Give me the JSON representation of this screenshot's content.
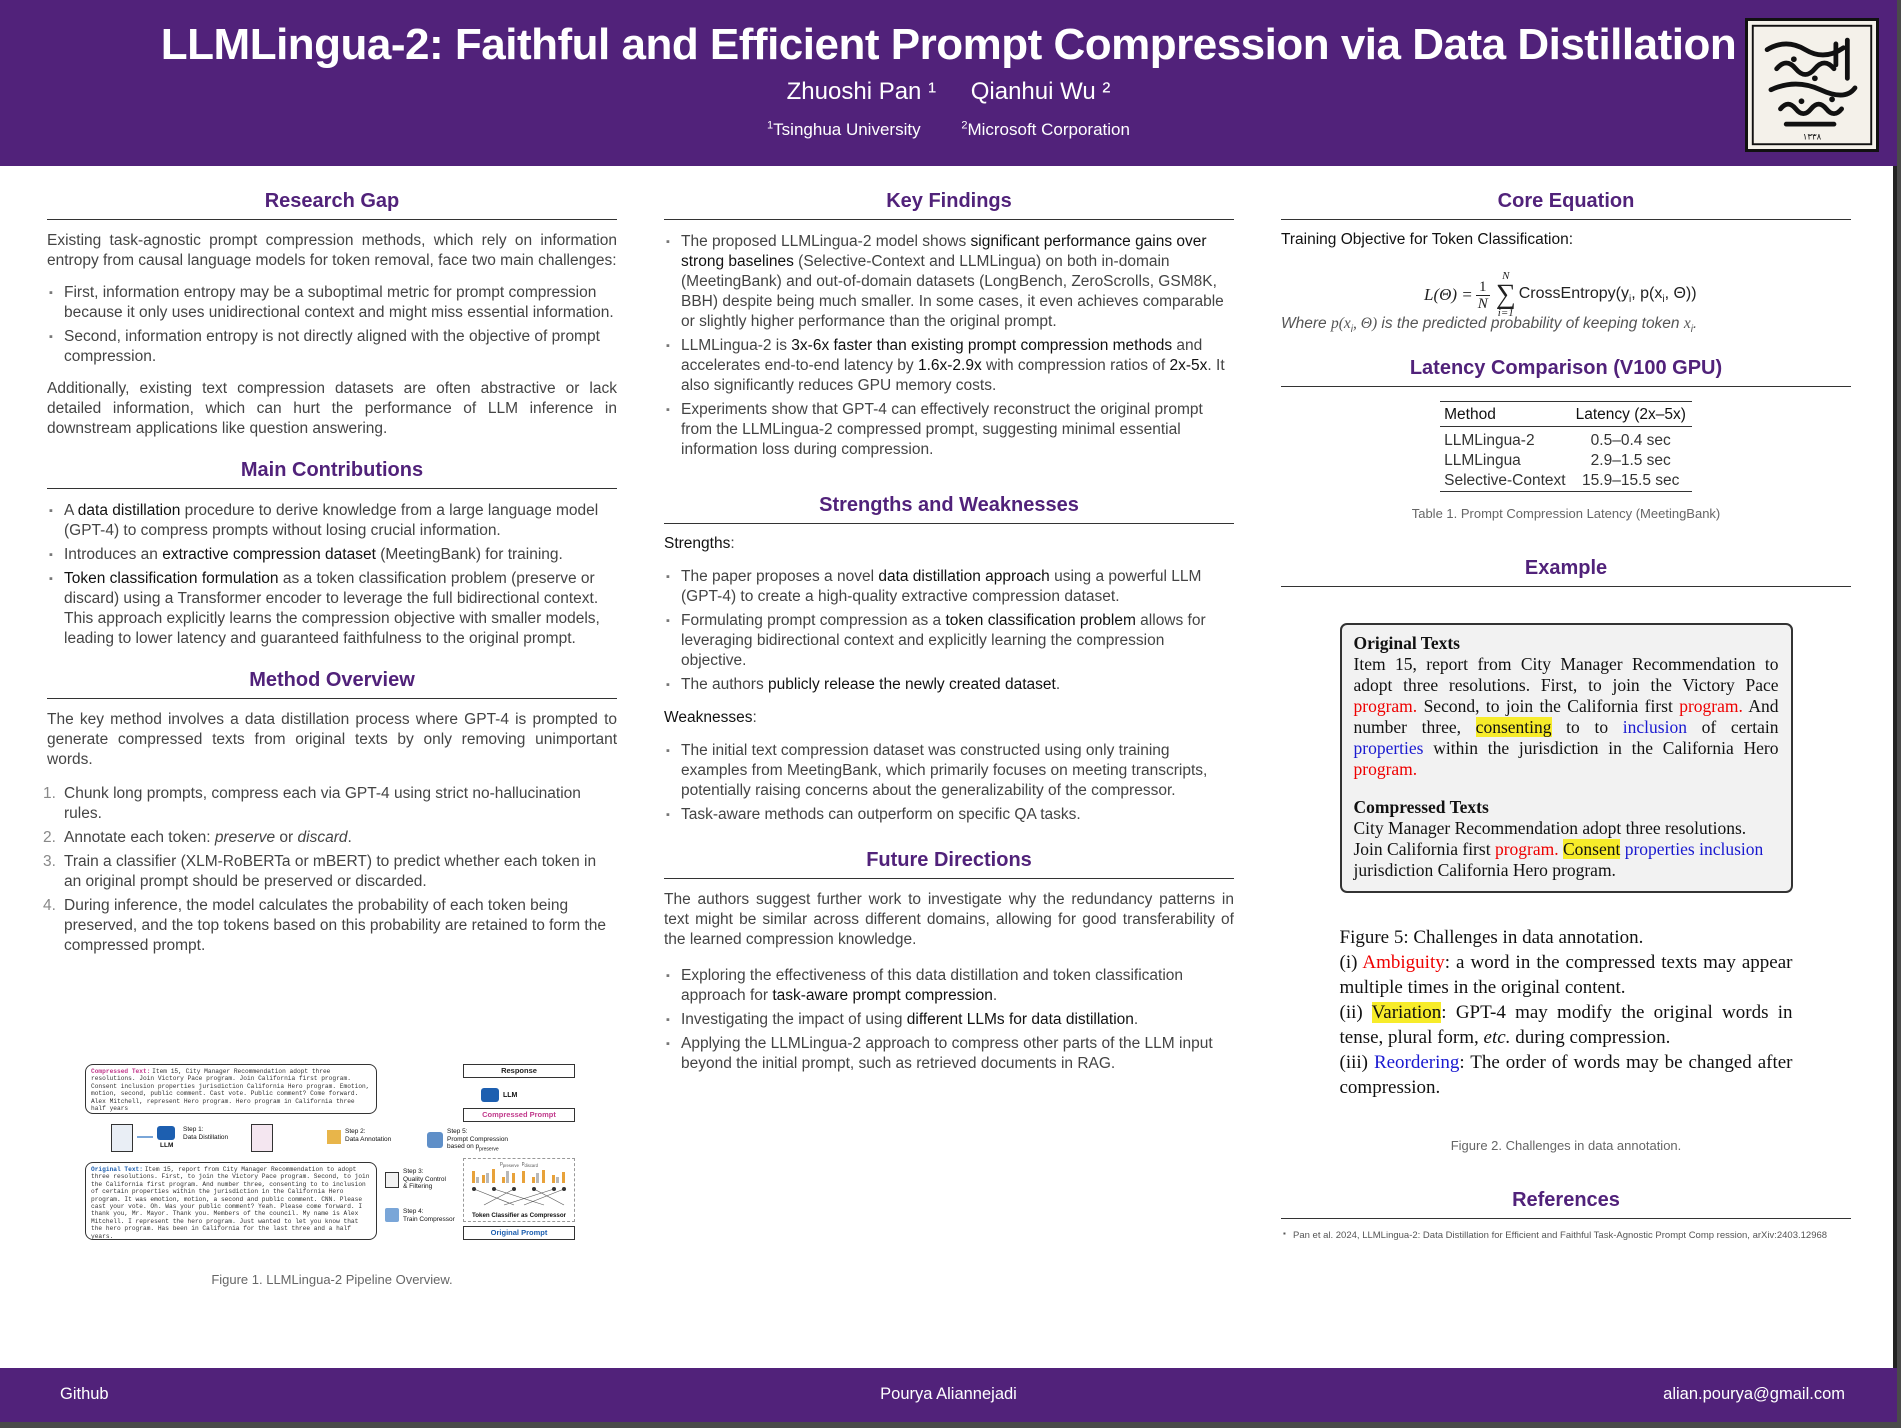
{
  "header": {
    "title": "LLMLingua-2: Faithful and Efficient Prompt Compression via Data Distillation",
    "authors": [
      "Zhuoshi Pan ¹",
      "Qianhui Wu ²"
    ],
    "affiliations": [
      {
        "sup": "1",
        "name": "Tsinghua University"
      },
      {
        "sup": "2",
        "name": "Microsoft Corporation"
      }
    ]
  },
  "research_gap": {
    "heading": "Research Gap",
    "intro": "Existing task-agnostic prompt compression methods, which rely on information entropy from causal language models for token removal, face two main challenges:",
    "bullets": [
      "First, information entropy may be a suboptimal metric for prompt compression because it only uses unidirectional context and might miss essential information.",
      "Second, information entropy is not directly aligned with the objective of prompt compression."
    ],
    "outro": "Additionally, existing text compression datasets are often abstractive or lack detailed information, which can hurt the performance of LLM inference in downstream applications like question answering."
  },
  "contributions": {
    "heading": "Main Contributions",
    "b1_pre": "A ",
    "b1_key": "data distillation",
    "b1_post": " procedure to derive knowledge from a large language model (GPT-4) to compress prompts without losing crucial information.",
    "b2_pre": "Introduces an ",
    "b2_key": "extractive compression dataset",
    "b2_post": " (MeetingBank) for training.",
    "b3_key": "Token classification formulation",
    "b3_post": " as a token classification problem (preserve or discard) using a Transformer encoder to leverage the full bidirectional context. This approach explicitly learns the compression objective with smaller models, leading to lower latency and guaranteed faithfulness to the original prompt."
  },
  "method": {
    "heading": "Method Overview",
    "intro": "The key method involves a data distillation process where GPT-4 is prompted to generate compressed texts from original texts by only removing unimportant words.",
    "steps": [
      {
        "n": "1.",
        "text": "Chunk long prompts, compress each via GPT-4 using strict no-hallucination rules."
      },
      {
        "n": "2.",
        "pre": "Annotate each token: ",
        "i1": "preserve",
        "mid": " or ",
        "i2": "discard",
        "post": "."
      },
      {
        "n": "3.",
        "text": "Train a classifier (XLM-RoBERTa or mBERT) to predict whether each token in an original prompt should be preserved or discarded."
      },
      {
        "n": "4.",
        "text": "During inference, the model calculates the probability of each token being preserved, and the top tokens based on this probability are retained to form the compressed prompt."
      }
    ],
    "figure_caption": "Figure 1. LLMLingua-2 Pipeline Overview.",
    "figure": {
      "compressed_label": "Compressed Text:",
      "compressed_body": "Item 15, City Manager Recommendation adopt three resolutions. Join Victory Pace program. Join California first program. Consent inclusion properties jurisdiction California Hero program. Emotion, motion, second, public comment. Cast vote. Public comment? Come forward. Alex Mitchell, represent Hero program. Hero program in California three half years",
      "original_label": "Original Text:",
      "original_body": "Item 15, report from City Manager Recommendation to adopt three resolutions. First, to join the Victory Pace program. Second, to join the California first program. And number three, consenting to to inclusion of certain properties within the jurisdiction in the California Hero program. It was emotion, motion, a second and public comment. CNN. Please cast your vote. Oh. Was your public comment? Yeah. Please come forward. I thank you, Mr. Mayor. Thank you. Members of the council. My name is Alex Mitchell. I represent the hero program. Just wanted to let you know that the hero program. Has been in California for the last three and a half years.",
      "step1": "Step 1:",
      "step1b": "Data Distillation",
      "step2": "Step 2:",
      "step2b": "Data Annotation",
      "step3": "Step 3:",
      "step3b": "Quality Control",
      "step3c": "& Filtering",
      "step4": "Step 4:",
      "step4b": "Train Compressor",
      "step5": "Step 5:",
      "step5b": "Prompt Compression",
      "step5c": "based on p",
      "step5d": "preserve",
      "llm": "LLM",
      "response": "Response",
      "compressed_prompt": "Compressed Prompt",
      "original_prompt": "Original Prompt",
      "classifier": "Token Classifier as Compressor",
      "legend1": "p",
      "legend1s": "preserve",
      "legend2": "p",
      "legend2s": "discard"
    }
  },
  "key_findings": {
    "heading": "Key Findings",
    "f1_pre": "The proposed LLMLingua-2 model shows ",
    "f1_key": "significant performance gains over strong baselines",
    "f1_post": " (Selective-Context and LLMLingua) on both in-domain (MeetingBank) and out-of-domain datasets (LongBench, ZeroScrolls, GSM8K, BBH) despite being much smaller. In some cases, it even achieves comparable or slightly higher performance than the original prompt.",
    "f2_pre": "LLMLingua-2 is ",
    "f2_key": "3x-6x faster than existing prompt compression methods",
    "f2_mid": " and accelerates end-to-end latency by ",
    "f2_key2": "1.6x-2.9x",
    "f2_mid2": " with compression ratios of ",
    "f2_key3": "2x-5x",
    "f2_post": ". It also significantly reduces GPU memory costs.",
    "f3": "Experiments show that GPT-4 can effectively reconstruct the original prompt from the LLMLingua-2 compressed prompt, suggesting minimal essential information loss during compression."
  },
  "strengths": {
    "heading": "Strengths and Weaknesses",
    "strengths_label": "Strengths",
    "s1_pre": "The paper proposes a novel ",
    "s1_key": "data distillation approach",
    "s1_post": " using a powerful LLM (GPT-4) to create a high-quality extractive compression dataset.",
    "s2_pre": "Formulating prompt compression as a ",
    "s2_key": "token classification problem",
    "s2_post": " allows for leveraging bidirectional context and explicitly learning the compression objective.",
    "s3_pre": "The authors ",
    "s3_key": "publicly release the newly created dataset",
    "s3_post": ".",
    "weaknesses_label": "Weaknesses",
    "w1": "The initial text compression dataset was constructed using only training examples from MeetingBank, which primarily focuses on meeting transcripts, potentially raising concerns about the generalizability of the compressor.",
    "w2": "Task-aware methods can outperform on specific QA tasks."
  },
  "future": {
    "heading": "Future Directions",
    "intro": "The authors suggest further work to investigate why the redundancy patterns in text might be similar across different domains, allowing for good transferability of the learned compression knowledge.",
    "d1_pre": "Exploring the effectiveness of this data distillation and token classification approach for ",
    "d1_key": "task-aware prompt compression",
    "d1_post": ".",
    "d2_pre": "Investigating the impact of using ",
    "d2_key": "different LLMs for data distillation",
    "d2_post": ".",
    "d3": "Applying the LLMLingua-2 approach to compress other parts of the LLM input beyond the initial prompt, such as retrieved documents in RAG."
  },
  "equation": {
    "heading": "Core Equation",
    "label": "Training Objective for Token Classification",
    "lhs": "L(Θ) = ",
    "frac_num": "1",
    "frac_den": "N",
    "sum_top": "N",
    "sum_bot": "i=1",
    "body": "CrossEntropy(y",
    "body_sub": "i",
    "body2": ", p(x",
    "body2_sub": "i",
    "body3": ", Θ))",
    "where_pre": "Where ",
    "where_expr": "p(x",
    "where_sub": "i",
    "where_expr2": ", Θ)",
    "where_mid": " is the predicted probability of keeping token ",
    "where_tok": "x",
    "where_tok_sub": "i",
    "where_post": "."
  },
  "latency": {
    "heading": "Latency Comparison (V100 GPU)",
    "columns": [
      "Method",
      "Latency (2x–5x)"
    ],
    "rows": [
      {
        "method": "LLMLingua-2",
        "latency": "0.5–0.4 sec"
      },
      {
        "method": "LLMLingua",
        "latency": "2.9–1.5 sec"
      },
      {
        "method": "Selective-Context",
        "latency": "15.9–15.5 sec"
      }
    ],
    "caption": "Table 1. Prompt Compression Latency (MeetingBank)"
  },
  "example": {
    "heading": "Example",
    "orig_title": "Original Texts",
    "orig_1": "Item 15, report from City Manager Recommendation to adopt three resolutions.  First, to join the Victory Pace ",
    "orig_prog1": "program.",
    "orig_2": "  Second, to join the California first ",
    "orig_prog2": "program.",
    "orig_3": " And number three, ",
    "orig_consenting": "consenting",
    "orig_4": " to to ",
    "orig_inclusion": "inclusion",
    "orig_5": " of certain ",
    "orig_properties": "properties",
    "orig_6": " within the jurisdiction in the California Hero ",
    "orig_prog3": "program.",
    "comp_title": "Compressed Texts",
    "comp_1": "City Manager Recommendation adopt three resolutions. Join California first ",
    "comp_prog": "program.",
    "comp_2": " ",
    "comp_consent": "Consent",
    "comp_3": " ",
    "comp_prop_incl": "properties inclusion",
    "comp_4": " jurisdiction California Hero program.",
    "fig5_title": "Figure 5: Challenges in data annotation.",
    "fig5_i": "(i) ",
    "fig5_amb": "Ambiguity",
    "fig5_i_rest": ": a word in the compressed texts may appear multiple times in the original content.",
    "fig5_ii": "(ii) ",
    "fig5_var": "Variation",
    "fig5_ii_rest1": ": GPT-4 may modify the original words in tense, plural form, ",
    "fig5_etc": "etc.",
    "fig5_ii_rest2": " during compression.",
    "fig5_iii": "(iii) ",
    "fig5_reo": "Reordering",
    "fig5_iii_rest": ": The order of words may be changed after compression.",
    "caption": "Figure 2. Challenges in data annotation."
  },
  "references": {
    "heading": "References",
    "items": [
      "Pan et al. 2024, LLMLingua-2: Data Distillation for Efficient and Faithful Task-Agnostic Prompt Comp ression, arXiv:2403.12968"
    ]
  },
  "footer": {
    "left": "Github",
    "center": "Pourya Aliannejadi",
    "right": "alian.pourya@gmail.com"
  },
  "colors": {
    "brand": "#51227a",
    "heading": "#51227a",
    "highlight": "#f7ec2a",
    "red": "#e00000",
    "blue": "#1a1ad0"
  }
}
